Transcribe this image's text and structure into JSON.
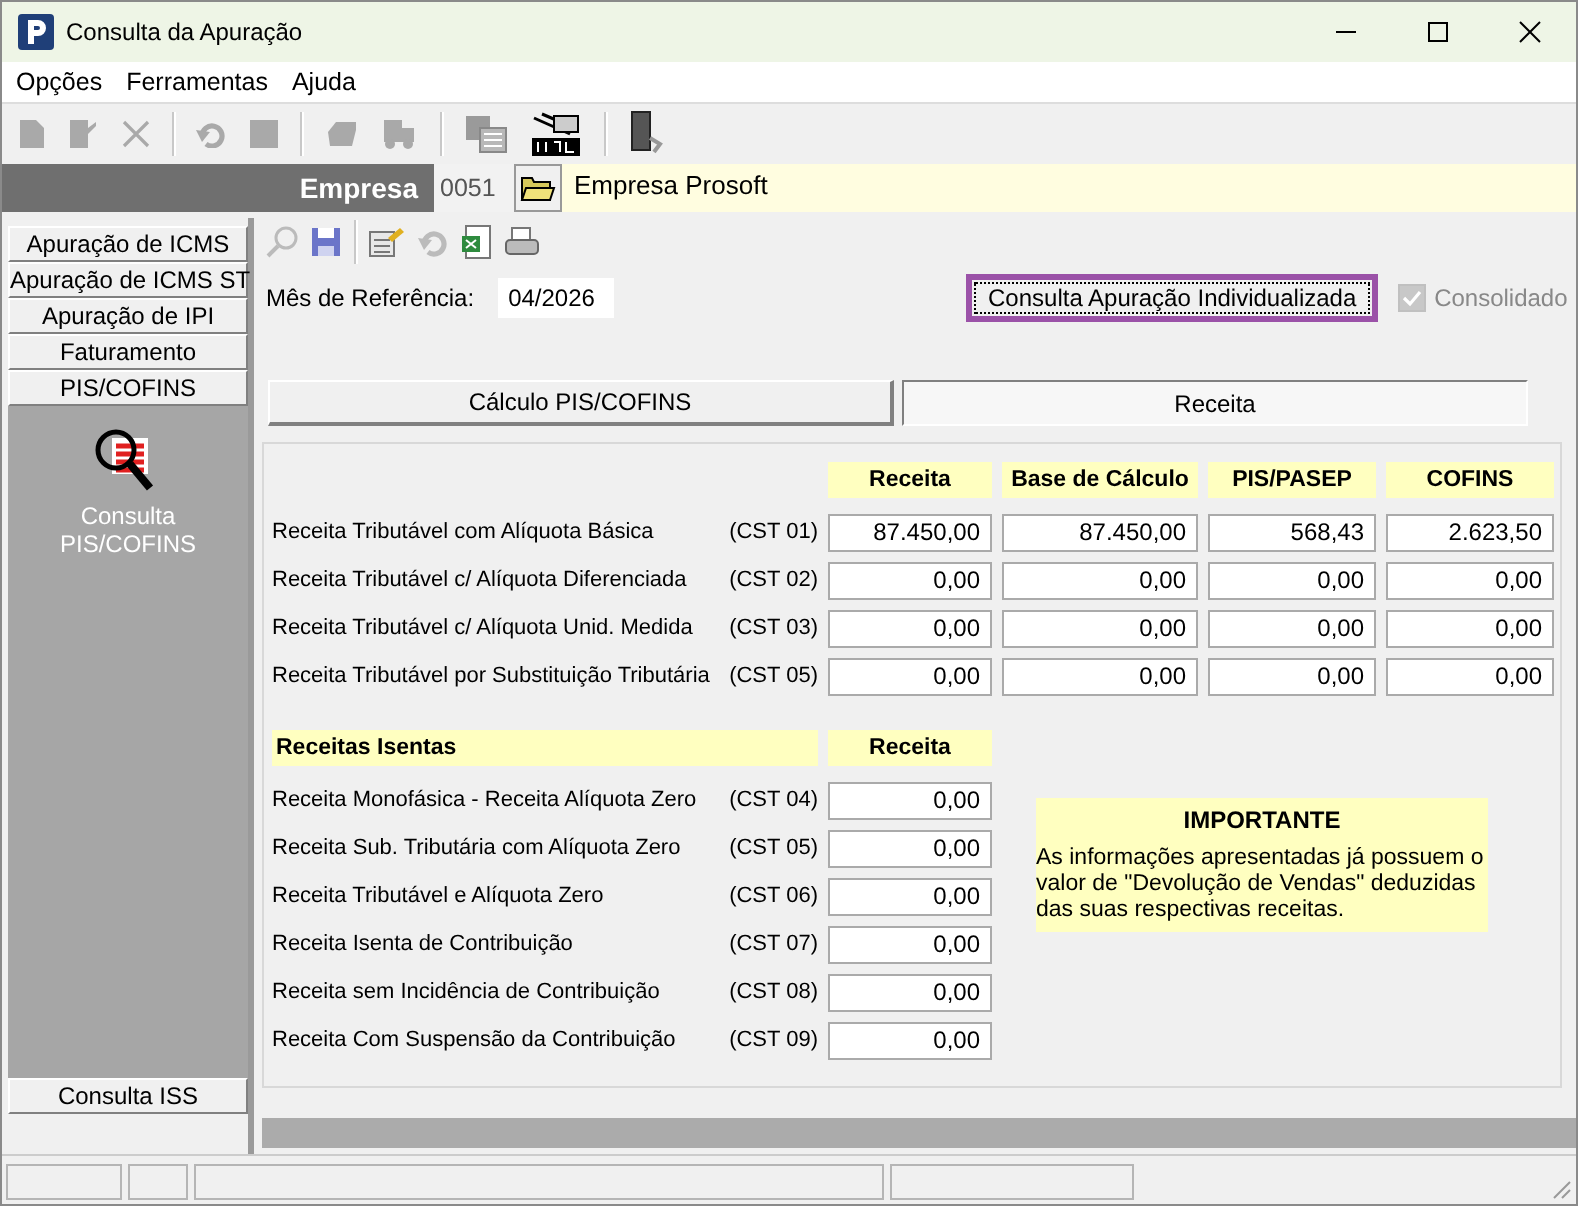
{
  "window": {
    "title": "Consulta da Apuração"
  },
  "menu": [
    "Opções",
    "Ferramentas",
    "Ajuda"
  ],
  "company": {
    "label": "Empresa",
    "code": "0051",
    "name": "Empresa Prosoft"
  },
  "sidebar": {
    "tabs": [
      "Apuração de ICMS",
      "Apuração de ICMS ST",
      "Apuração de IPI",
      "Faturamento",
      "PIS/COFINS"
    ],
    "shortcut": "Consulta PIS/COFINS",
    "bottom_tab": "Consulta ISS"
  },
  "reference": {
    "label": "Mês de Referência:",
    "value": "04/2026"
  },
  "individual_button": "Consulta Apuração Individualizada",
  "consolidated": {
    "label": "Consolidado",
    "checked": true,
    "disabled": true
  },
  "subtabs": [
    {
      "label": "Cálculo PIS/COFINS",
      "selected": false
    },
    {
      "label": "Receita",
      "selected": true
    }
  ],
  "taxable": {
    "columns": [
      "Receita",
      "Base de Cálculo",
      "PIS/PASEP",
      "COFINS"
    ],
    "rows": [
      {
        "label": "Receita Tributável com Alíquota Básica",
        "cst": "(CST 01)",
        "values": [
          "87.450,00",
          "87.450,00",
          "568,43",
          "2.623,50"
        ]
      },
      {
        "label": "Receita Tributável c/ Alíquota Diferenciada",
        "cst": "(CST 02)",
        "values": [
          "0,00",
          "0,00",
          "0,00",
          "0,00"
        ]
      },
      {
        "label": "Receita Tributável c/ Alíquota Unid. Medida",
        "cst": "(CST 03)",
        "values": [
          "0,00",
          "0,00",
          "0,00",
          "0,00"
        ]
      },
      {
        "label": "Receita Tributável por Substituição Tributária",
        "cst": "(CST 05)",
        "values": [
          "0,00",
          "0,00",
          "0,00",
          "0,00"
        ]
      }
    ]
  },
  "exempt": {
    "title": "Receitas Isentas",
    "column": "Receita",
    "rows": [
      {
        "label": "Receita Monofásica - Receita Alíquota Zero",
        "cst": "(CST 04)",
        "value": "0,00"
      },
      {
        "label": "Receita Sub. Tributária com Alíquota Zero",
        "cst": "(CST 05)",
        "value": "0,00"
      },
      {
        "label": "Receita Tributável e Alíquota Zero",
        "cst": "(CST 06)",
        "value": "0,00"
      },
      {
        "label": "Receita Isenta de Contribuição",
        "cst": "(CST 07)",
        "value": "0,00"
      },
      {
        "label": "Receita sem Incidência de Contribuição",
        "cst": "(CST 08)",
        "value": "0,00"
      },
      {
        "label": "Receita Com Suspensão da Contribuição",
        "cst": "(CST 09)",
        "value": "0,00"
      }
    ]
  },
  "notice": {
    "title": "IMPORTANTE",
    "text": "As informações apresentadas já possuem o valor de \"Devolução de Vendas\" deduzidas das suas respectivas receitas."
  }
}
